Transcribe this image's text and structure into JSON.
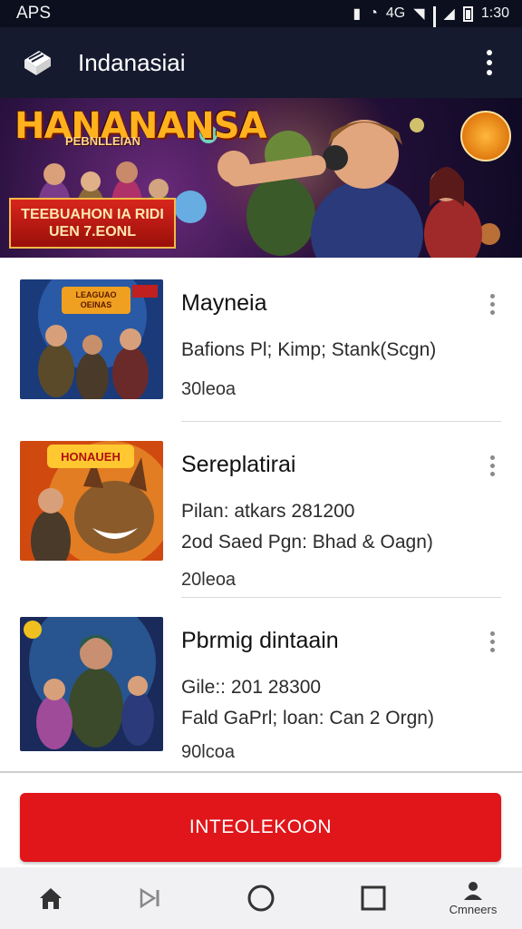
{
  "status_bar": {
    "left_text": "APS",
    "time": "1:30",
    "network_text": "4G"
  },
  "app_bar": {
    "title": "Indanasiai",
    "logo_icon": "cube-logo-icon",
    "menu_icon": "more-vertical-icon"
  },
  "banner": {
    "title": "HANANANSA",
    "subtitle": "PEBNLLEIAN",
    "ribbon_text": "TEEBUAHON IA RIDI UEN 7.EONL"
  },
  "games": [
    {
      "name": "Mayneia",
      "line1": "Bafions Pl; Kimp; Stank(Scgn)",
      "line2": "",
      "line3": "30leoa",
      "thumb_label": "LEAGUAO OEINAS"
    },
    {
      "name": "Sereplatirai",
      "line1": "Pilan: atkars 281200",
      "line2": "2od Saed Pgn: Bhad & Oagn)",
      "line3": "20leoa",
      "thumb_label": "HONAUEH"
    },
    {
      "name": "Pbrmig dintaain",
      "line1": "Gile:: 201 28300",
      "line2": "Fald GaPrl; loan: Can 2 Orgn)",
      "line3": "90lcoa",
      "thumb_label": ""
    }
  ],
  "cta_button": {
    "label": "INTEOLEKOON"
  },
  "nav_bar": {
    "items": [
      {
        "icon": "home-icon",
        "label": ""
      },
      {
        "icon": "forward-icon",
        "label": ""
      },
      {
        "icon": "circle-home-icon",
        "label": ""
      },
      {
        "icon": "square-recents-icon",
        "label": ""
      },
      {
        "icon": "person-icon",
        "label": "Cmneers"
      }
    ]
  },
  "colors": {
    "app_bar_bg": "#151a2e",
    "cta_red": "#e0161a",
    "nav_bg": "#f1f1f3"
  }
}
